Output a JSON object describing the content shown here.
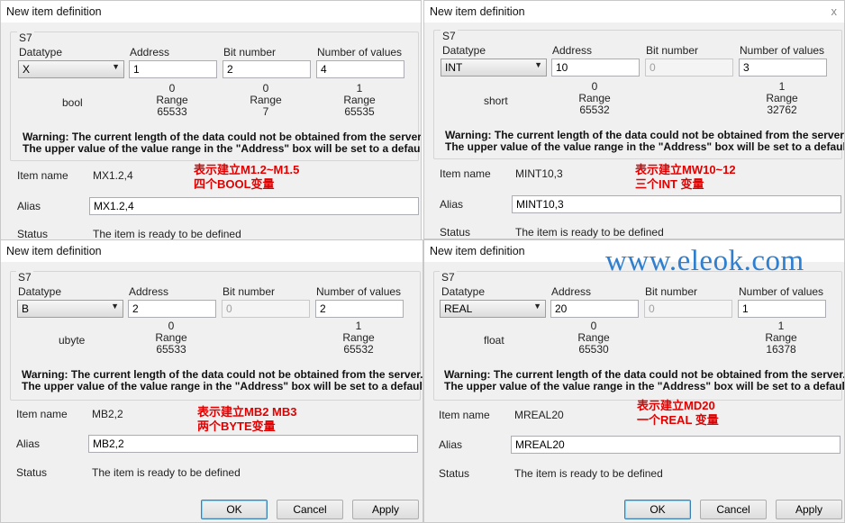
{
  "common": {
    "window_title": "New item definition",
    "group_label": "S7",
    "datatype_label": "Datatype",
    "address_label": "Address",
    "bit_label": "Bit number",
    "num_label": "Number of values",
    "range_label": "Range",
    "warning_line1": "Warning: The current length of the data could not be obtained from the server.",
    "warning_line2": "The upper value of the value range in the \"Address\" box will be set to a default val",
    "item_name_label": "Item name",
    "alias_label": "Alias",
    "status_label": "Status",
    "status_text": "The item is ready to be defined",
    "ok_label": "OK",
    "cancel_label": "Cancel",
    "apply_label": "Apply",
    "close_glyph": "x"
  },
  "dialogs": [
    {
      "datatype": "X",
      "address": "1",
      "bit": "2",
      "num": "4",
      "type_name": "bool",
      "addr_min": "0",
      "addr_max": "65533",
      "bit_min": "0",
      "bit_max": "7",
      "num_min": "1",
      "num_max": "65535",
      "item_name": "MX1.2,4",
      "alias": "MX1.2,4",
      "anno_line1": "表示建立M1.2~M1.5",
      "anno_line2": "四个BOOL变量"
    },
    {
      "datatype": "INT",
      "address": "10",
      "bit": "0",
      "num": "3",
      "type_name": "short",
      "addr_min": "0",
      "addr_max": "65532",
      "num_min": "1",
      "num_max": "32762",
      "item_name": "MINT10,3",
      "alias": "MINT10,3",
      "anno_line1": "表示建立MW10~12",
      "anno_line2": "三个INT 变量"
    },
    {
      "datatype": "B",
      "address": "2",
      "bit": "0",
      "num": "2",
      "type_name": "ubyte",
      "addr_min": "0",
      "addr_max": "65533",
      "num_min": "1",
      "num_max": "65532",
      "item_name": "MB2,2",
      "alias": "MB2,2",
      "anno_line1": "表示建立MB2   MB3",
      "anno_line2": "两个BYTE变量"
    },
    {
      "datatype": "REAL",
      "address": "20",
      "bit": "0",
      "num": "1",
      "type_name": "float",
      "addr_min": "0",
      "addr_max": "65530",
      "num_min": "1",
      "num_max": "16378",
      "item_name": "MREAL20",
      "alias": "MREAL20",
      "anno_line1": "表示建立MD20",
      "anno_line2": "一个REAL 变量"
    }
  ],
  "watermark": "www.eleok.com"
}
